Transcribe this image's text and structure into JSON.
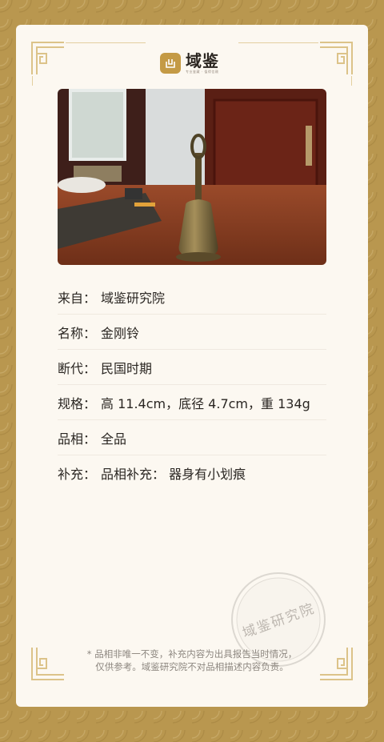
{
  "brand": {
    "name": "域鉴",
    "slogan": "专业鉴藏 · 值得信赖",
    "accent_color": "#c49a45",
    "border_color": "#b9974f"
  },
  "photo": {
    "icon": "bronze-bell-photo"
  },
  "info": [
    {
      "label": "来自：",
      "value": "域鉴研究院"
    },
    {
      "label": "名称：",
      "value": "金刚铃"
    },
    {
      "label": "断代：",
      "value": "民国时期"
    },
    {
      "label": "规格：",
      "value": "高 11.4cm，底径 4.7cm，重 134g"
    },
    {
      "label": "品相：",
      "value": "全品"
    },
    {
      "label": "补充：",
      "value": "品相补充：  器身有小划痕"
    }
  ],
  "disclaimer": {
    "line1": "* 品相非唯一不变，补充内容为出具报告当时情况，",
    "line2": "仅供参考。域鉴研究院不对品相描述内容负责。"
  },
  "seal": {
    "text": "域鉴研究院"
  }
}
